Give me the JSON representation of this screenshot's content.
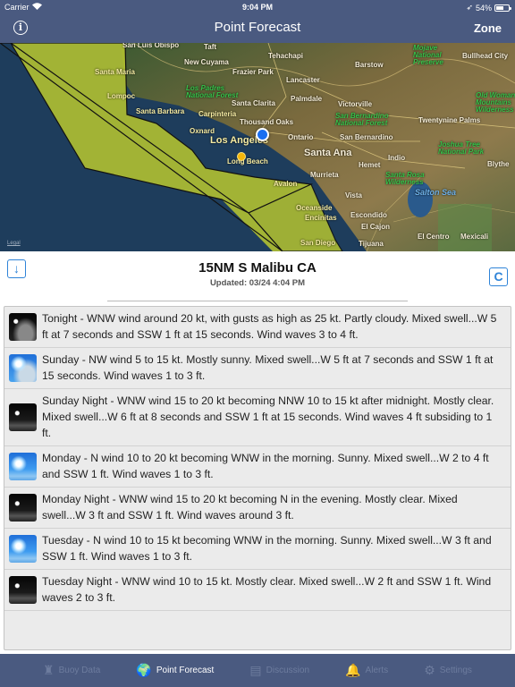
{
  "status_bar": {
    "carrier": "Carrier",
    "time": "9:04 PM",
    "battery": "54%",
    "battery_level": 0.54
  },
  "nav": {
    "title": "Point Forecast",
    "info_icon": "info-icon",
    "zone_label": "Zone"
  },
  "map": {
    "legal": "Legal",
    "labels": [
      {
        "text": "San Luis Obispo",
        "style": ""
      },
      {
        "text": "Taft",
        "style": ""
      },
      {
        "text": "New Cuyama",
        "style": ""
      },
      {
        "text": "Frazier Park",
        "style": ""
      },
      {
        "text": "Tehachapi",
        "style": ""
      },
      {
        "text": "Barstow",
        "style": ""
      },
      {
        "text": "Mojave National Preserve",
        "style": "green"
      },
      {
        "text": "Bullhead City",
        "style": ""
      },
      {
        "text": "Santa Maria",
        "style": "yellow"
      },
      {
        "text": "Los Padres National Forest",
        "style": "green"
      },
      {
        "text": "Lancaster",
        "style": ""
      },
      {
        "text": "Palmdale",
        "style": ""
      },
      {
        "text": "Victorville",
        "style": ""
      },
      {
        "text": "Old Woman Mountains Wilderness",
        "style": "green"
      },
      {
        "text": "Lompoc",
        "style": "yellow"
      },
      {
        "text": "Santa Clarita",
        "style": ""
      },
      {
        "text": "San Bernardino National Forest",
        "style": "green"
      },
      {
        "text": "Santa Barbara",
        "style": "yellow"
      },
      {
        "text": "Carpinteria",
        "style": "yellow"
      },
      {
        "text": "Thousand Oaks",
        "style": ""
      },
      {
        "text": "Twentynine Palms",
        "style": ""
      },
      {
        "text": "Oxnard",
        "style": "yellow"
      },
      {
        "text": "Los Angeles",
        "style": "yellow"
      },
      {
        "text": "Ontario",
        "style": ""
      },
      {
        "text": "San Bernardino",
        "style": ""
      },
      {
        "text": "Joshua Tree National Park",
        "style": "green"
      },
      {
        "text": "Long Beach",
        "style": "yellow"
      },
      {
        "text": "Santa Ana",
        "style": ""
      },
      {
        "text": "Indio",
        "style": ""
      },
      {
        "text": "Hemet",
        "style": ""
      },
      {
        "text": "Blythe",
        "style": ""
      },
      {
        "text": "Murrieta",
        "style": ""
      },
      {
        "text": "Santa Rosa Wilderness",
        "style": "green"
      },
      {
        "text": "Avalon",
        "style": "yellow"
      },
      {
        "text": "Salton Sea",
        "style": "blue"
      },
      {
        "text": "Vista",
        "style": ""
      },
      {
        "text": "Oceanside",
        "style": "yellow"
      },
      {
        "text": "Escondido",
        "style": ""
      },
      {
        "text": "Encinitas",
        "style": "yellow"
      },
      {
        "text": "El Cajon",
        "style": ""
      },
      {
        "text": "El Centro",
        "style": ""
      },
      {
        "text": "Mexicali",
        "style": ""
      },
      {
        "text": "San Diego",
        "style": "yellow"
      },
      {
        "text": "Tijuana",
        "style": ""
      }
    ]
  },
  "header": {
    "location": "15NM S Malibu CA",
    "updated": "Updated: 03/24 4:04 PM"
  },
  "forecast": [
    {
      "icon": "night-cloudy",
      "text": "Tonight - WNW wind around 20 kt, with gusts as high as 25 kt. Partly cloudy. Mixed swell...W 5 ft at  7 seconds and SSW 1 ft at 15 seconds. Wind waves 3 to 4 ft."
    },
    {
      "icon": "mostly-sunny",
      "text": "Sunday - NW wind 5 to 15 kt. Mostly sunny. Mixed swell...W 5 ft at  7 seconds and SSW 1 ft at 15 seconds. Wind waves 1 to 3 ft."
    },
    {
      "icon": "night",
      "text": "Sunday Night - WNW wind 15 to 20 kt becoming NNW 10 to 15 kt after midnight. Mostly clear. Mixed swell...W 6 ft at  8 seconds and SSW 1 ft at 15 seconds. Wind waves 4 ft subsiding to 1 ft."
    },
    {
      "icon": "sunny",
      "text": "Monday - N wind 10 to 20 kt becoming WNW in the morning. Sunny. Mixed swell...W 2 to 4 ft and SSW 1 ft. Wind waves 1 to 3 ft."
    },
    {
      "icon": "night",
      "text": "Monday Night - WNW wind 15 to 20 kt becoming N in the evening. Mostly clear. Mixed swell...W 3 ft and SSW 1 ft. Wind waves around 3 ft."
    },
    {
      "icon": "sunny",
      "text": "Tuesday - N wind 10 to 15 kt becoming WNW in the morning. Sunny. Mixed swell...W 3 ft and SSW 1 ft. Wind waves 1 to 3 ft."
    },
    {
      "icon": "night",
      "text": "Tuesday Night - WNW wind 10 to 15 kt. Mostly clear. Mixed swell...W 2 ft and SSW 1 ft. Wind waves 2 to 3 ft."
    }
  ],
  "tabs": [
    {
      "label": "Buoy Data",
      "icon": "buoy-icon",
      "glyph": "♜",
      "active": false
    },
    {
      "label": "Point Forecast",
      "icon": "globe-icon",
      "glyph": "🌍",
      "active": true
    },
    {
      "label": "Discussion",
      "icon": "document-icon",
      "glyph": "▤",
      "active": false
    },
    {
      "label": "Alerts",
      "icon": "bell-icon",
      "glyph": "🔔",
      "active": false
    },
    {
      "label": "Settings",
      "icon": "gear-icon",
      "glyph": "⚙",
      "active": false
    }
  ],
  "colors": {
    "nav_bg": "#4a5a80",
    "accent": "#2f84d8",
    "warning_zone": "#b5c430",
    "ocean": "#1e3d5c"
  }
}
